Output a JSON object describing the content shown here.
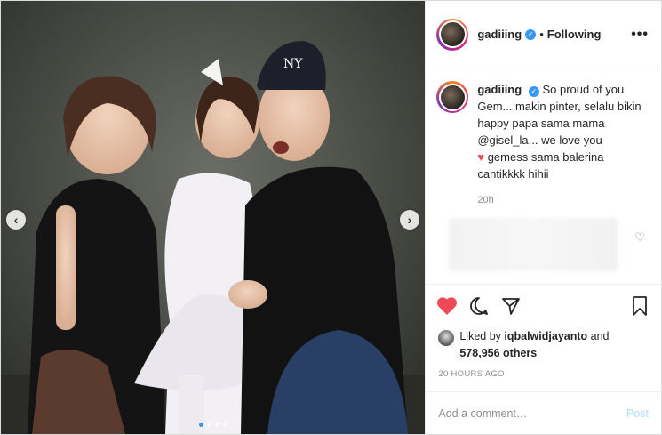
{
  "post": {
    "username": "gadiiing",
    "verified_icon": "verified-badge-icon",
    "bullet": "•",
    "follow_status": "Following",
    "more_icon": "•••",
    "caption": {
      "username": "gadiiing",
      "text_line1": "So proud of you Gem... makin pinter, selalu bikin happy papa sama mama @gisel_la... we love you",
      "heart": "♥",
      "text_line2": "gemess sama balerina cantikkkk hihii",
      "time": "20h"
    },
    "comment_like_icon": "♡",
    "likes": {
      "prefix": "Liked by ",
      "user": "iqbalwidjayanto",
      "and": " and",
      "count": "578,956 others"
    },
    "timestamp": "20 HOURS AGO",
    "comment_input": {
      "placeholder": "Add a comment…",
      "post_label": "Post"
    },
    "carousel": {
      "prev": "‹",
      "next": "›",
      "dots": 4,
      "active_dot": 1
    },
    "colors": {
      "liked_heart": "#ed4956",
      "verified": "#3897f0",
      "post_button": "#b3dbff"
    }
  }
}
